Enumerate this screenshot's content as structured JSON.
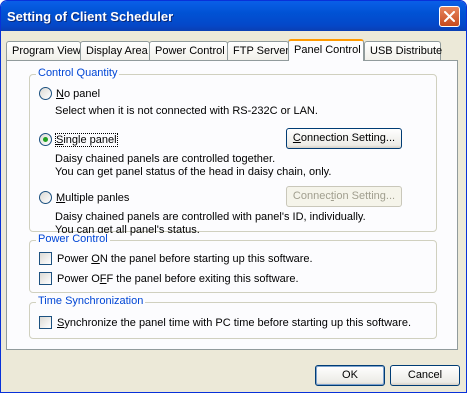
{
  "window": {
    "title": "Setting of Client Scheduler"
  },
  "tabs": [
    {
      "label": "Program Viewer"
    },
    {
      "label": "Display Area"
    },
    {
      "label": "Power Control"
    },
    {
      "label": "FTP Server"
    },
    {
      "label": "Panel Control"
    },
    {
      "label": "USB Distribute"
    }
  ],
  "active_tab": "Panel Control",
  "control_quantity": {
    "legend": "Control Quantity",
    "no_panel": {
      "label_key": "N",
      "label_rest": "o panel",
      "selected": false,
      "desc": "Select when it is not connected with RS-232C or LAN."
    },
    "single_panel": {
      "label": "Single panel",
      "label_underline_char": "S",
      "selected": true,
      "desc1": "Daisy chained panels are controlled together.",
      "desc2": "You can get panel status of the head in daisy chain, only.",
      "button_pre": "",
      "button_key": "C",
      "button_post": "onnection Setting...",
      "button_enabled": true
    },
    "multiple_panels": {
      "label_key": "M",
      "label_rest": "ultiple panles",
      "selected": false,
      "desc1": "Daisy chained panels are controlled with panel's ID, individually.",
      "desc2": "You can get all panel's status.",
      "button_pre": "Connec",
      "button_key": "t",
      "button_post": "ion Setting...",
      "button_enabled": false
    }
  },
  "power_control": {
    "legend": "Power Control",
    "power_on": {
      "pre": "Power ",
      "key": "O",
      "post": "N the panel before starting up this software.",
      "checked": false
    },
    "power_off": {
      "pre": "Power O",
      "key": "F",
      "post": "F the panel before exiting this software.",
      "checked": false
    }
  },
  "time_sync": {
    "legend": "Time Synchronization",
    "sync": {
      "key": "S",
      "post": "ynchronize the panel time with PC time before starting up this software.",
      "checked": false
    }
  },
  "footer": {
    "ok_label": "OK",
    "cancel_label": "Cancel"
  },
  "colors": {
    "accent_blue": "#0046d5",
    "titlebar": "#0052d4",
    "tab_highlight": "#ff9a00",
    "radio_dot": "#21a121"
  }
}
